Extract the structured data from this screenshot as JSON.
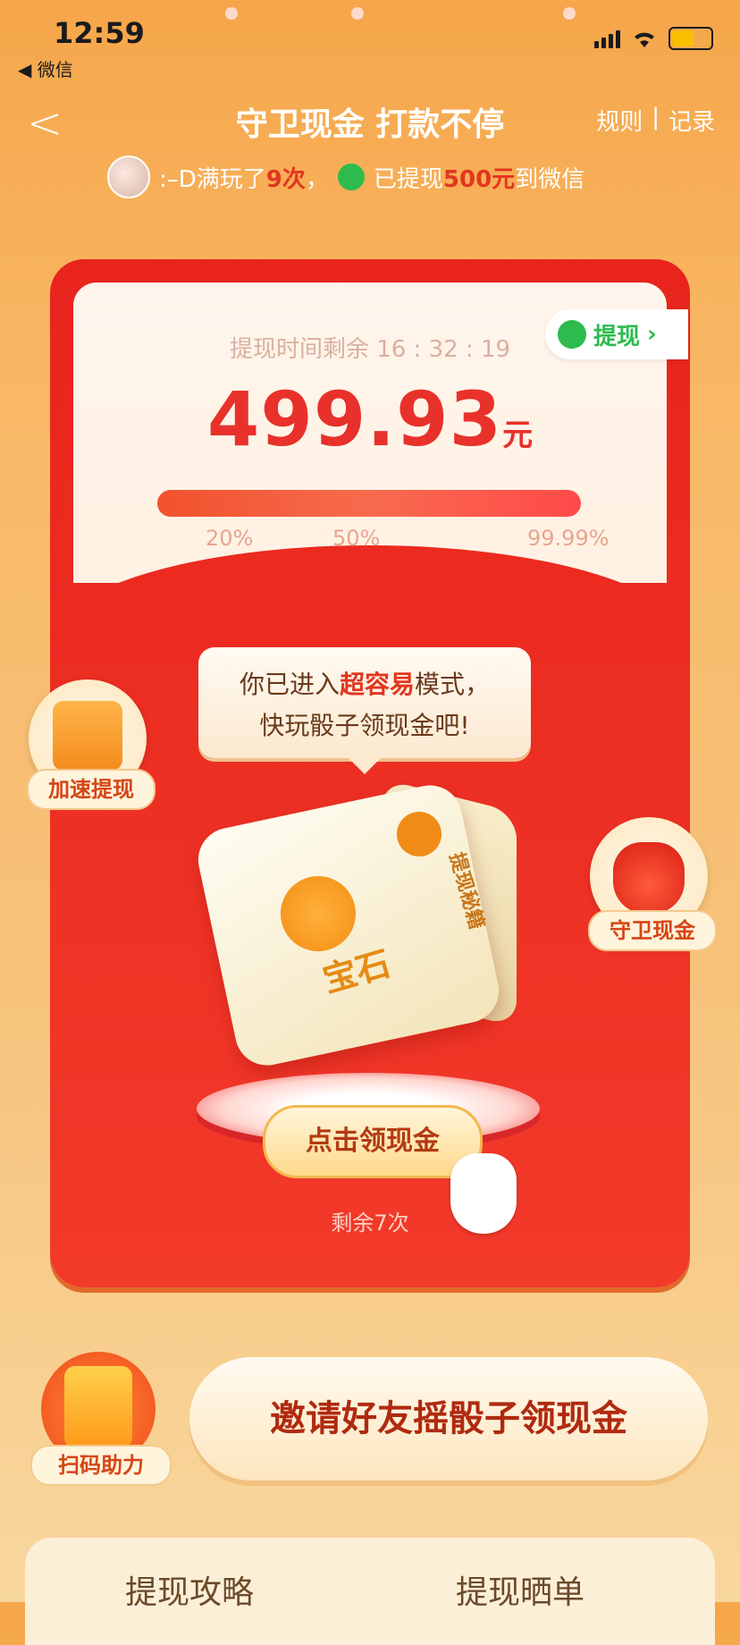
{
  "status": {
    "time": "12:59",
    "back_app": "◀ 微信"
  },
  "header": {
    "title": "守卫现金 打款不停",
    "rules": "规则",
    "divider": "|",
    "records": "记录"
  },
  "ticker": {
    "prefix": ":–D满玩了",
    "count": "9次",
    "sep": "，",
    "action": "已提现",
    "amount": "500元",
    "suffix": "到微信"
  },
  "card": {
    "countdown_label": "提现时间剩余 16 : 32 : 19",
    "withdraw_label": "提现",
    "withdraw_arrow": "›",
    "amount": "499.93",
    "amount_unit": "元",
    "progress": {
      "level": 0.9999,
      "ticks": [
        "20%",
        "50%",
        "99.99%"
      ]
    }
  },
  "bubble": {
    "line1_prefix": "你已进入",
    "line1_highlight": "超容易",
    "line1_suffix": "模式，",
    "line2": "快玩骰子领现金吧!"
  },
  "side": {
    "speed_label": "加速提现",
    "guard_label": "守卫现金"
  },
  "dice": {
    "face_label": "宝石",
    "side_label": "提现秘籍"
  },
  "claim": {
    "button": "点击领现金",
    "remaining": "剩余7次"
  },
  "bottom": {
    "scan_label": "扫码助力",
    "invite_button": "邀请好友摇骰子领现金",
    "tab1": "提现攻略",
    "tab2": "提现晒单"
  }
}
